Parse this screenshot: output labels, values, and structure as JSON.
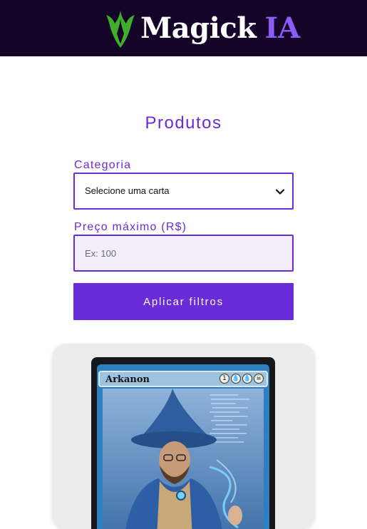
{
  "header": {
    "logo_text": "Magick",
    "logo_accent": "IA"
  },
  "page": {
    "title": "Produtos"
  },
  "filters": {
    "category_label": "Categoria",
    "category_value": "Selecione uma carta",
    "price_label": "Preço máximo (R$)",
    "price_placeholder": "Ex: 100",
    "apply_label": "Aplicar filtros"
  },
  "products": [
    {
      "card_name": "Arkanon",
      "mana_cost": [
        "1",
        "water-drop",
        "water-drop",
        "skull"
      ]
    }
  ],
  "colors": {
    "header_bg": "#140428",
    "accent_purple": "#6a2bd9",
    "logo_accent": "#8b5cf6",
    "logo_icon_green": "#3fae2a",
    "card_bg": "#ececec",
    "input_bg": "#f2eefa"
  },
  "icons": {
    "logo_icon": "green-flame-icon",
    "select_chevron": "chevron-down-icon"
  }
}
